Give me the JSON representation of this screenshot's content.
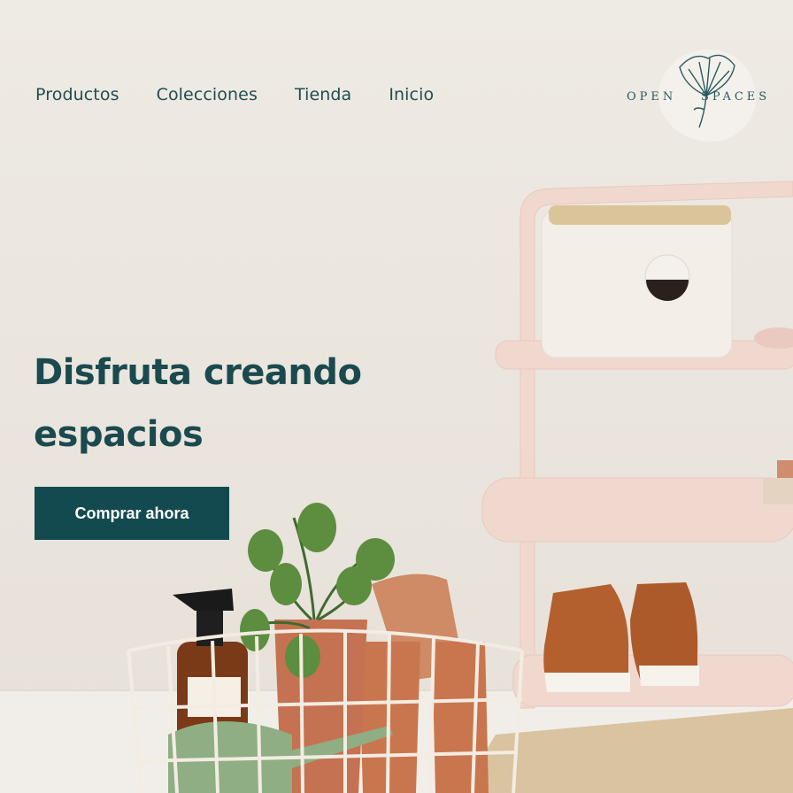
{
  "nav": {
    "items": [
      {
        "label": "Productos"
      },
      {
        "label": "Colecciones"
      },
      {
        "label": "Tienda"
      },
      {
        "label": "Inicio"
      }
    ]
  },
  "brand": {
    "word1": "OPEN",
    "word2": "SPACES"
  },
  "hero": {
    "headline": "Disfruta creando espacios",
    "cta_label": "Comprar ahora"
  },
  "colors": {
    "accent": "#134a50",
    "text": "#1a4a4e",
    "background": "#ece7e1"
  }
}
